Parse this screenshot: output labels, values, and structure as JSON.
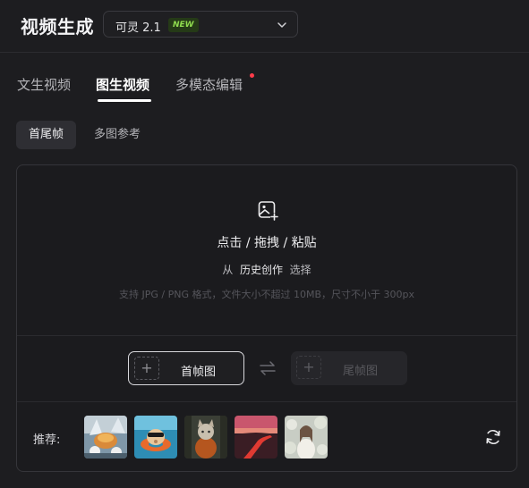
{
  "header": {
    "title": "视频生成",
    "model_select": {
      "value": "可灵 2.1",
      "badge": "NEW"
    }
  },
  "tabs": [
    {
      "label": "文生视频",
      "active": false
    },
    {
      "label": "图生视频",
      "active": true
    },
    {
      "label": "多模态编辑",
      "active": false,
      "notification_dot": true
    }
  ],
  "subtabs": [
    {
      "label": "首尾帧",
      "active": true
    },
    {
      "label": "多图参考",
      "active": false
    }
  ],
  "upload": {
    "main_text": "点击 / 拖拽 / 粘贴",
    "history_prefix": "从",
    "history_link": "历史创作",
    "history_suffix": "选择",
    "hint": "支持 JPG / PNG 格式，文件大小不超过 10MB，尺寸不小于 300px"
  },
  "frames": {
    "first_label": "首帧图",
    "last_label": "尾帧图",
    "last_enabled": false
  },
  "recommend": {
    "label": "推荐:",
    "thumbnails": [
      {
        "name": "rec-thumb-snow-cake"
      },
      {
        "name": "rec-thumb-hamster-float"
      },
      {
        "name": "rec-thumb-cat-forest"
      },
      {
        "name": "rec-thumb-sunset-river"
      },
      {
        "name": "rec-thumb-woman-flowers"
      }
    ]
  },
  "colors": {
    "background": "#1d1d20",
    "accent_new": "#8fdb4e",
    "notification": "#ff3b4a"
  }
}
